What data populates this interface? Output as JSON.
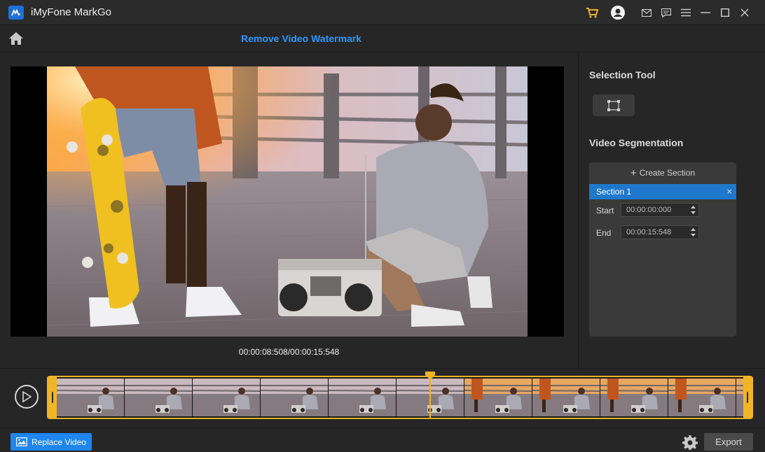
{
  "app": {
    "title": "iMyFone MarkGo"
  },
  "titlebar_icons": [
    "cart-icon",
    "account-icon",
    "mail-icon",
    "feedback-icon",
    "menu-icon",
    "minimize-icon",
    "maximize-icon",
    "close-icon"
  ],
  "header": {
    "title": "Remove Video Watermark"
  },
  "preview": {
    "timecode": "00:00:08:508/00:00:15:548"
  },
  "panel": {
    "selection_tool_heading": "Selection Tool",
    "segmentation_heading": "Video Segmentation",
    "create_section_label": "Create Section",
    "sections": [
      {
        "label": "Section 1",
        "start_label": "Start",
        "start_value": "00:00:00:000",
        "end_label": "End",
        "end_value": "00:00:15:548"
      }
    ]
  },
  "timeline": {
    "thumbnail_count": 11,
    "playhead_fraction": 0.547
  },
  "bottom": {
    "replace_label": "Replace Video",
    "export_label": "Export"
  },
  "colors": {
    "accent": "#1e86ee",
    "title_blue": "#2f97ff",
    "timeline_gold": "#f0b526"
  }
}
